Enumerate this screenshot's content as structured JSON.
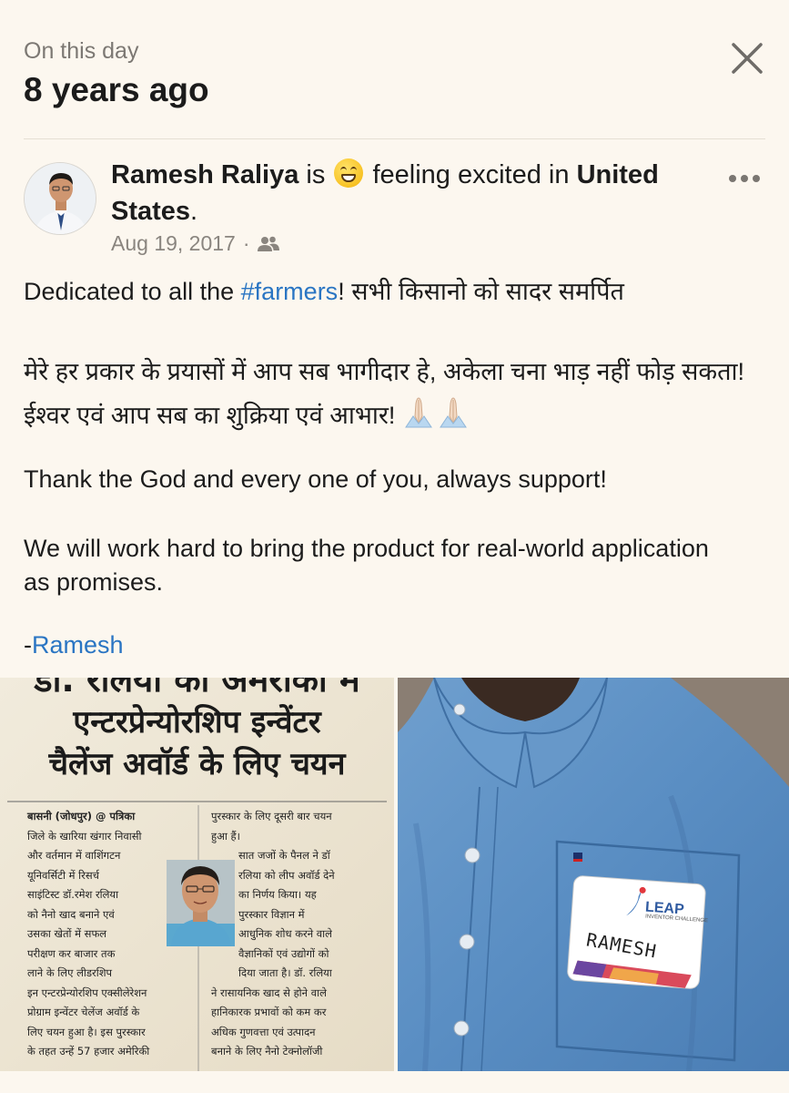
{
  "header": {
    "kicker": "On this day",
    "title": "8 years ago"
  },
  "post": {
    "author": "Ramesh Raliya",
    "is_text": "is",
    "feeling_text": "feeling excited in",
    "location": "United States",
    "location_suffix": ".",
    "date": "Aug 19, 2017",
    "separator": "·",
    "body": {
      "p1_prefix": "Dedicated to all the ",
      "p1_hashtag": "#farmers",
      "p1_suffix": "! सभी किसानो को सादर समर्पित",
      "p2": "मेरे हर प्रकार के प्रयासों में आप सब भागीदार हे, अकेला चना भाड़ नहीं फोड़ सकता!  ईश्वर एवं आप सब का शुक्रिया एवं आभार!",
      "p3": "Thank the God and every one of you, always support!",
      "p4": "We will work hard to bring the product for real-world application as promises.",
      "p5_dash": "-",
      "p5_link": "Ramesh"
    }
  },
  "icons": {
    "close": "close-icon",
    "more": "more-options-icon",
    "audience": "friends-audience-icon",
    "feeling": "excited-emoji-icon",
    "pray": "folded-hands-icon"
  },
  "newspaper": {
    "headline_line1": "डा. रलिया का अमरीका में",
    "headline_line2": "एन्टरप्रेन्योरशिप इन्वेंटर",
    "headline_line3": "चैलेंज अवॉर्ड के लिए चयन",
    "dateline": "बासनी (जोधपुर) @ पत्रिका",
    "col1": [
      "जिले के खारिया खंगार निवासी",
      "और वर्तमान में वाशिंगटन",
      "यूनिवर्सिटी में रिसर्च",
      "साइंटिस्ट डॉ.रमेश रलिया",
      "को नैनो खाद बनाने एवं",
      "उसका खेतों में सफल",
      "परीक्षण कर बाजार तक",
      "लाने के लिए लीडरशिप",
      "इन एन्टरप्रेन्योरशिप एक्सीलेरेशन",
      "प्रोग्राम इन्वेंटर चेलेंज अवॉर्ड के",
      "लिए चयन हुआ है। इस पुरस्कार",
      "के तहत उन्हें 57 हजार अमेरिकी"
    ],
    "col2": [
      "पुरस्कार के लिए दूसरी बार चयन",
      "हुआ हैं।",
      "सात जजों के पैनल ने डॉ",
      "रलिया को लीप अवॉर्ड देने",
      "का निर्णय किया। यह",
      "पुरस्कार विज्ञान में",
      "आधुनिक शोध करने वाले",
      "वैज्ञानिकों एवं उद्योगों को",
      "दिया जाता है। डॉ. रलिया",
      "ने रासायनिक खाद से होने वाले",
      "हानिकारक प्रभावों को कम कर",
      "अधिक गुणवत्ता एवं उत्पादन",
      "बनाने के लिए नैनो टेक्नोलॉजी"
    ]
  },
  "badge": {
    "brand": "LEAP",
    "subtitle": "INVENTOR CHALLENGE",
    "name": "RAMESH"
  },
  "colors": {
    "background": "#fcf7ef",
    "link": "#2a75c3",
    "muted": "#8a857f",
    "shirt": "#5b8fc2"
  }
}
